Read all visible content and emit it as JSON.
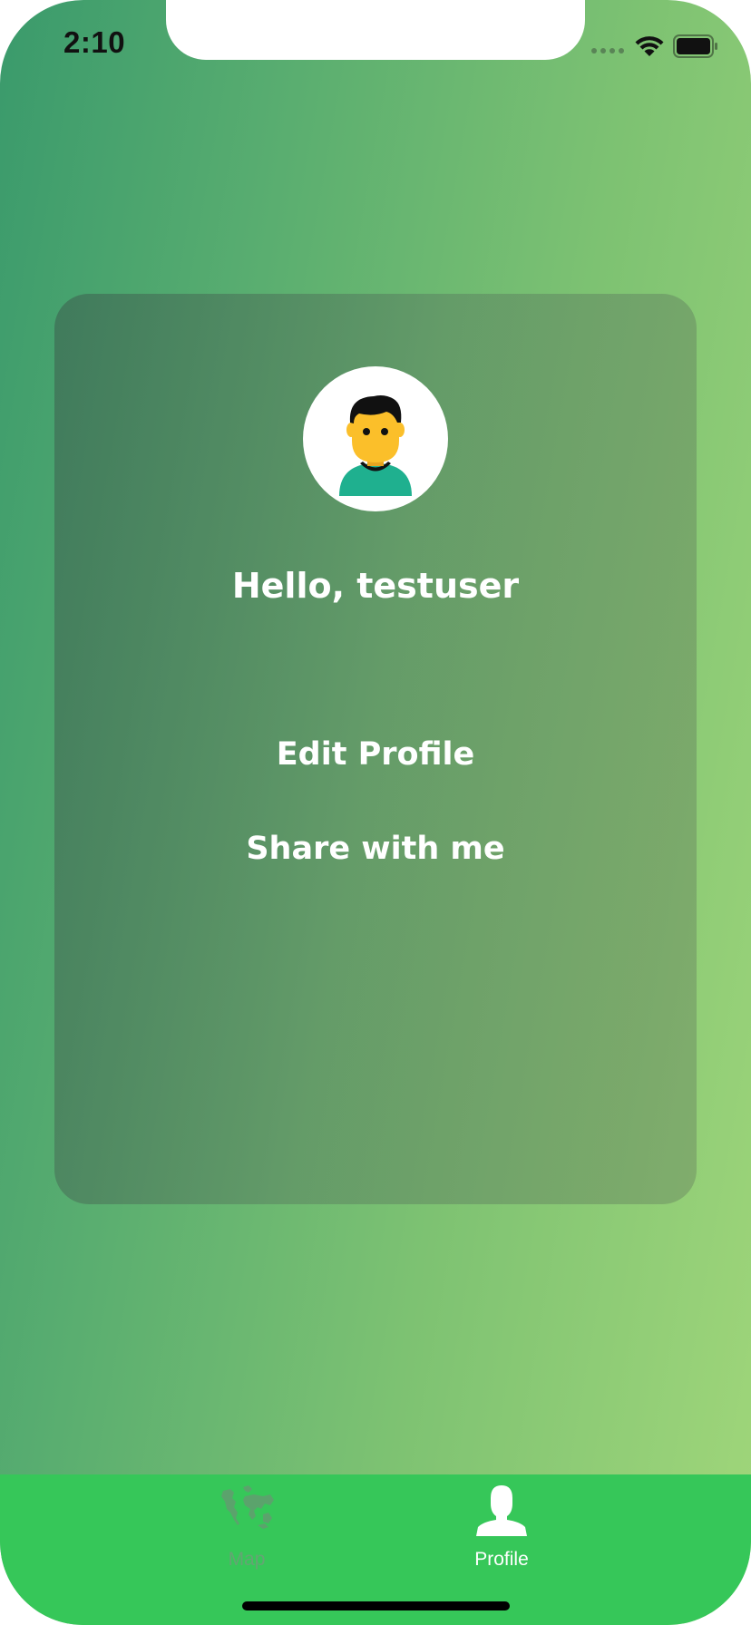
{
  "status_bar": {
    "time": "2:10",
    "wifi_icon": "wifi-icon",
    "battery_icon": "battery-icon",
    "signal_icon": "cellular-signal-icon"
  },
  "profile": {
    "avatar_icon": "user-avatar-icon",
    "greeting": "Hello, testuser"
  },
  "menu": {
    "edit_profile": "Edit Profile",
    "share_with_me": "Share with me"
  },
  "tab_bar": {
    "tabs": [
      {
        "label": "Map",
        "icon": "world-map-icon",
        "selected": false
      },
      {
        "label": "Profile",
        "icon": "person-icon",
        "selected": true
      }
    ]
  },
  "colors": {
    "gradient_start": "#3a9a6c",
    "gradient_end": "#a0d67a",
    "tab_bar": "#36c759",
    "avatar_skin": "#fbbf2a",
    "avatar_shirt": "#1fb08f"
  }
}
